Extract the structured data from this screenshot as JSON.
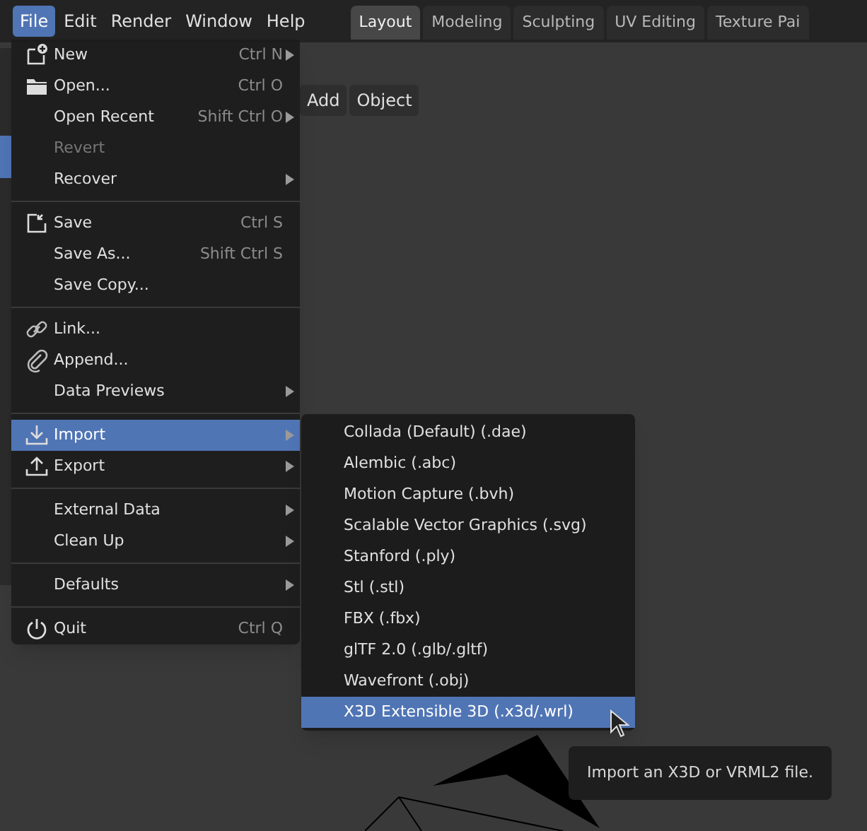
{
  "menu_bar": [
    {
      "label": "File",
      "selected": true
    },
    {
      "label": "Edit",
      "selected": false
    },
    {
      "label": "Render",
      "selected": false
    },
    {
      "label": "Window",
      "selected": false
    },
    {
      "label": "Help",
      "selected": false
    }
  ],
  "workspace_tabs": [
    {
      "label": "Layout",
      "selected": true
    },
    {
      "label": "Modeling",
      "selected": false
    },
    {
      "label": "Sculpting",
      "selected": false
    },
    {
      "label": "UV Editing",
      "selected": false
    },
    {
      "label": "Texture Pai",
      "selected": false
    }
  ],
  "viewport_header": {
    "buttons": [
      "Add",
      "Object"
    ]
  },
  "file_menu": {
    "sections": [
      {
        "items": [
          {
            "kind": "new",
            "label": "New",
            "shortcut": "Ctrl N",
            "submenu": true,
            "disabled": false,
            "selected": false
          },
          {
            "kind": "open",
            "label": "Open...",
            "shortcut": "Ctrl O",
            "submenu": false,
            "disabled": false,
            "selected": false
          },
          {
            "label": "Open Recent",
            "shortcut": "Shift Ctrl O",
            "submenu": true,
            "disabled": false,
            "selected": false
          },
          {
            "label": "Revert",
            "submenu": false,
            "disabled": true,
            "selected": false
          },
          {
            "label": "Recover",
            "submenu": true,
            "disabled": false,
            "selected": false
          }
        ]
      },
      {
        "items": [
          {
            "kind": "save",
            "label": "Save",
            "shortcut": "Ctrl S",
            "submenu": false,
            "disabled": false,
            "selected": false
          },
          {
            "label": "Save As...",
            "shortcut": "Shift Ctrl S",
            "submenu": false,
            "disabled": false,
            "selected": false
          },
          {
            "label": "Save Copy...",
            "submenu": false,
            "disabled": false,
            "selected": false
          }
        ]
      },
      {
        "items": [
          {
            "kind": "link",
            "label": "Link...",
            "submenu": false,
            "disabled": false,
            "selected": false
          },
          {
            "kind": "append",
            "label": "Append...",
            "submenu": false,
            "disabled": false,
            "selected": false
          },
          {
            "label": "Data Previews",
            "submenu": true,
            "disabled": false,
            "selected": false
          }
        ]
      },
      {
        "items": [
          {
            "kind": "import",
            "label": "Import",
            "submenu": true,
            "disabled": false,
            "selected": true
          },
          {
            "kind": "export",
            "label": "Export",
            "submenu": true,
            "disabled": false,
            "selected": false
          }
        ]
      },
      {
        "items": [
          {
            "label": "External Data",
            "submenu": true,
            "disabled": false,
            "selected": false
          },
          {
            "label": "Clean Up",
            "submenu": true,
            "disabled": false,
            "selected": false
          }
        ]
      },
      {
        "items": [
          {
            "label": "Defaults",
            "submenu": true,
            "disabled": false,
            "selected": false
          }
        ]
      },
      {
        "items": [
          {
            "kind": "quit",
            "label": "Quit",
            "shortcut": "Ctrl Q",
            "submenu": false,
            "disabled": false,
            "selected": false
          }
        ]
      }
    ]
  },
  "import_submenu": {
    "items": [
      {
        "label": "Collada (Default) (.dae)",
        "selected": false
      },
      {
        "label": "Alembic (.abc)",
        "selected": false
      },
      {
        "label": "Motion Capture (.bvh)",
        "selected": false
      },
      {
        "label": "Scalable Vector Graphics (.svg)",
        "selected": false
      },
      {
        "label": "Stanford (.ply)",
        "selected": false
      },
      {
        "label": "Stl (.stl)",
        "selected": false
      },
      {
        "label": "FBX (.fbx)",
        "selected": false
      },
      {
        "label": "glTF 2.0 (.glb/.gltf)",
        "selected": false
      },
      {
        "label": "Wavefront (.obj)",
        "selected": false
      },
      {
        "label": "X3D Extensible 3D (.x3d/.wrl)",
        "selected": true
      }
    ]
  },
  "tooltip": {
    "text": "Import an X3D or VRML2 file."
  }
}
